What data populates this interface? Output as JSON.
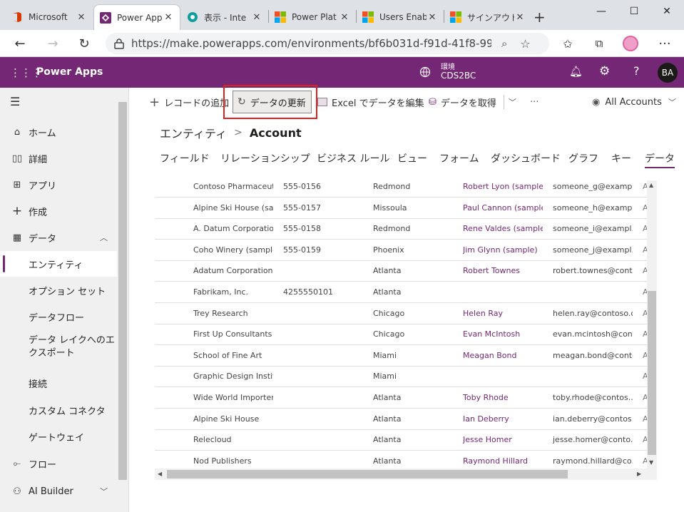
{
  "browser": {
    "tabs": [
      {
        "label": "Microsoft",
        "icon": "office-icon",
        "color": "#d83b01"
      },
      {
        "label": "Power Apps",
        "icon": "powerapps-icon",
        "color": "#742774"
      },
      {
        "label": "表示 - Inte",
        "icon": "dataverse-icon",
        "color": "#0f9d9d"
      },
      {
        "label": "Power Plat",
        "icon": "microsoft-logo-icon",
        "color": "#f25022"
      },
      {
        "label": "Users Enab",
        "icon": "microsoft-logo-icon",
        "color": "#f25022"
      },
      {
        "label": "サインアウト",
        "icon": "microsoft-logo-icon",
        "color": "#f25022"
      }
    ],
    "new_tab": "+",
    "url": "https://make.powerapps.com/environments/bf6b031d-f91d-41f8-99..."
  },
  "header": {
    "app_name": "Power Apps",
    "env_label": "環境",
    "env_name": "CDS2BC",
    "avatar": "BA"
  },
  "leftnav": {
    "items": [
      {
        "label": "ホーム",
        "icon": "home-icon"
      },
      {
        "label": "詳細",
        "icon": "book-icon"
      },
      {
        "label": "アプリ",
        "icon": "apps-icon"
      },
      {
        "label": "作成",
        "icon": "plus-icon"
      },
      {
        "label": "データ",
        "icon": "table-icon"
      },
      {
        "label": "エンティティ"
      },
      {
        "label": "オプション セット"
      },
      {
        "label": "データフロー"
      },
      {
        "label": "データ レイクへのエ"
      },
      {
        "label": "クスポート"
      },
      {
        "label": "接続"
      },
      {
        "label": "カスタム コネクタ"
      },
      {
        "label": "ゲートウェイ"
      },
      {
        "label": "フロー",
        "icon": "flow-icon"
      },
      {
        "label": "AI Builder",
        "icon": "ai-icon"
      }
    ]
  },
  "commandbar": {
    "add_record": "レコードの追加",
    "refresh": "データの更新",
    "excel": "Excel でデータを編集",
    "get_data": "データを取得",
    "more": "···",
    "view": "All Accounts"
  },
  "breadcrumb": {
    "parent": "エンティティ",
    "separator": ">",
    "current": "Account"
  },
  "entity_tabs": [
    "フィールド",
    "リレーションシップ",
    "ビジネス ルール",
    "ビュー",
    "フォーム",
    "ダッシュボード",
    "グラフ",
    "キー",
    "データ"
  ],
  "grid": {
    "rows": [
      [
        "Contoso Pharmaceut...",
        "555-0156",
        "Redmond",
        "Robert Lyon (sample)",
        "someone_g@exampl...",
        "A"
      ],
      [
        "Alpine Ski House (sa...",
        "555-0157",
        "Missoula",
        "Paul Cannon (sample)",
        "someone_h@exampl...",
        "A"
      ],
      [
        "A. Datum Corporatio...",
        "555-0158",
        "Redmond",
        "Rene Valdes (sample)",
        "someone_i@exampl...",
        "A"
      ],
      [
        "Coho Winery (sample)",
        "555-0159",
        "Phoenix",
        "Jim Glynn (sample)",
        "someone_j@exampl...",
        "A"
      ],
      [
        "Adatum Corporation",
        "",
        "Atlanta",
        "Robert Townes",
        "robert.townes@conto...",
        "A"
      ],
      [
        "Fabrikam, Inc.",
        "4255550101",
        "Atlanta",
        "",
        "",
        "A"
      ],
      [
        "Trey Research",
        "",
        "Chicago",
        "Helen Ray",
        "helen.ray@contoso.c...",
        "A"
      ],
      [
        "First Up Consultants",
        "",
        "Chicago",
        "Evan McIntosh",
        "evan.mcintosh@conto...",
        "A"
      ],
      [
        "School of Fine Art",
        "",
        "Miami",
        "Meagan Bond",
        "meagan.bond@conto...",
        "A"
      ],
      [
        "Graphic Design Instit...",
        "",
        "Miami",
        "",
        "",
        "A"
      ],
      [
        "Wide World Importers",
        "",
        "Atlanta",
        "Toby Rhode",
        "toby.rhode@contos...",
        "A"
      ],
      [
        "Alpine Ski House",
        "",
        "Atlanta",
        "Ian Deberry",
        "ian.deberry@contos...",
        "A"
      ],
      [
        "Relecloud",
        "",
        "Atlanta",
        "Jesse Homer",
        "jesse.homer@conto...",
        "A"
      ],
      [
        "Nod Publishers",
        "",
        "Atlanta",
        "Raymond Hillard",
        "raymond.hillard@co...",
        "A"
      ]
    ]
  },
  "colors": {
    "brand": "#742774",
    "highlight": "#e0201c"
  }
}
